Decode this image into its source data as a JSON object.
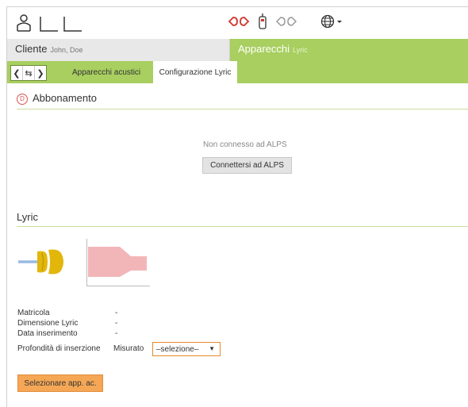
{
  "header": {
    "user_icon": "user-icon",
    "ears_icon": "hearing-aids-icon",
    "device_icons": [
      "hearing-aid-pair-red-icon",
      "remote-control-icon",
      "hearing-aid-pair-grey-icon"
    ],
    "globe_icon": "globe-icon"
  },
  "client": {
    "label": "Cliente",
    "name": "John, Doe"
  },
  "devices": {
    "label": "Apparecchi",
    "sub": "Lyric"
  },
  "tabs": [
    {
      "label": "Apparecchi acustici"
    },
    {
      "label": "Configurazione Lyric"
    }
  ],
  "subscription": {
    "badge": "D",
    "title": "Abbonamento",
    "status": "Non connesso ad ALPS",
    "connect_label": "Connettersi ad ALPS"
  },
  "lyric": {
    "title": "Lyric",
    "rows": [
      {
        "label": "Matricola",
        "value": "-"
      },
      {
        "label": "Dimensione Lyric",
        "value": "-"
      },
      {
        "label": "Data inserimento",
        "value": "-"
      }
    ],
    "depth_label": "Profondità di inserzione",
    "depth_mode": "Misurato",
    "depth_select": "–selezione–",
    "select_button": "Selezionare app. ac."
  },
  "colors": {
    "accent_green": "#a8cf60",
    "warning": "#f5a756",
    "alert": "#d9534f"
  }
}
